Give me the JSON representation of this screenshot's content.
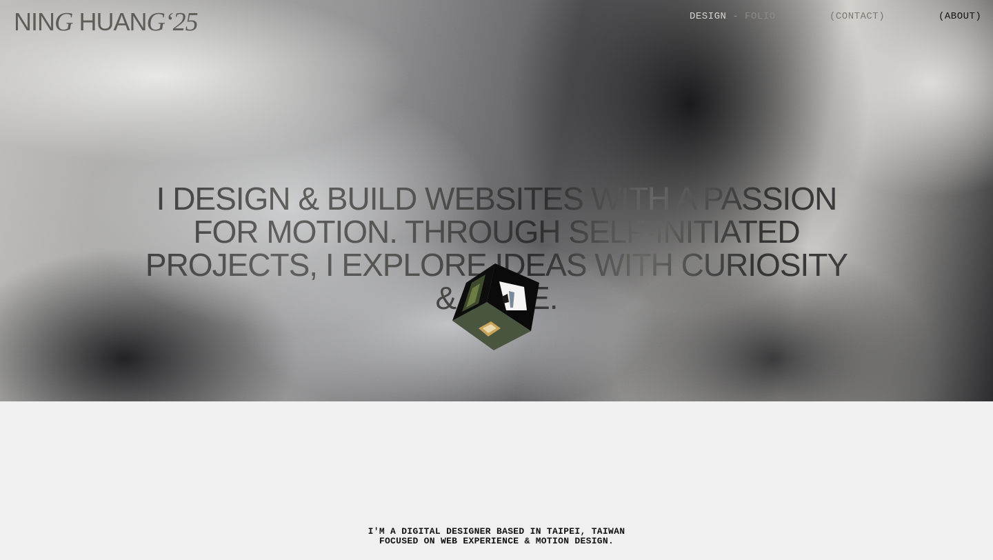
{
  "header": {
    "logo": {
      "part1": "NIN",
      "part2": "G",
      "part3": " HUAN",
      "part4": "G",
      "part5": "‘25"
    },
    "nav": {
      "design": "DESIGN",
      "separator": " - ",
      "folio": "FOLIO",
      "contact": "(CONTACT)",
      "about": "(ABOUT)"
    }
  },
  "hero": {
    "headline": "I DESIGN & BUILD WEBSITES WITH A PASSION FOR MOTION. THROUGH SELF-INITIATED PROJECTS, I EXPLORE IDEAS WITH CURIOSITY & CARE."
  },
  "intro": {
    "line1": "I'M A DIGITAL DESIGNER BASED IN TAIPEI, TAIWAN",
    "line2": "FOCUSED ON WEB EXPERIENCE & MOTION DESIGN."
  },
  "colors": {
    "page_background": "#f0f0f0",
    "text_dark": "#111111",
    "logo": "#5f5d57"
  }
}
